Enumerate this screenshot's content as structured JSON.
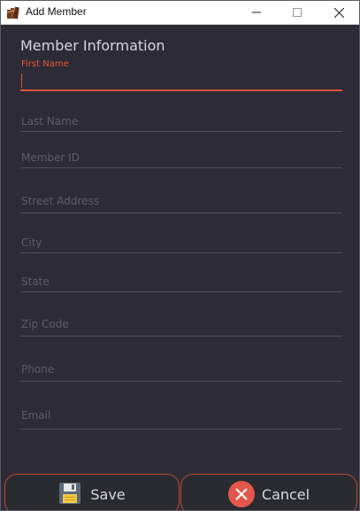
{
  "window": {
    "title": "Add Member"
  },
  "form": {
    "heading": "Member Information",
    "fields": [
      {
        "label": "First Name",
        "value": "",
        "focused": true
      },
      {
        "label": "Last Name",
        "value": ""
      },
      {
        "label": "Member ID",
        "value": ""
      },
      {
        "label": "Street Address",
        "value": ""
      },
      {
        "label": "City",
        "value": ""
      },
      {
        "label": "State",
        "value": ""
      },
      {
        "label": "Zip Code",
        "value": ""
      },
      {
        "label": "Phone",
        "value": ""
      },
      {
        "label": "Email",
        "value": ""
      }
    ]
  },
  "actions": {
    "save_label": "Save",
    "save_icon": "floppy-disk-icon",
    "cancel_label": "Cancel",
    "cancel_icon": "close-circle-icon"
  },
  "colors": {
    "accent": "#e0553a",
    "background": "#2d2c36",
    "cancel_icon": "#e2574c"
  }
}
